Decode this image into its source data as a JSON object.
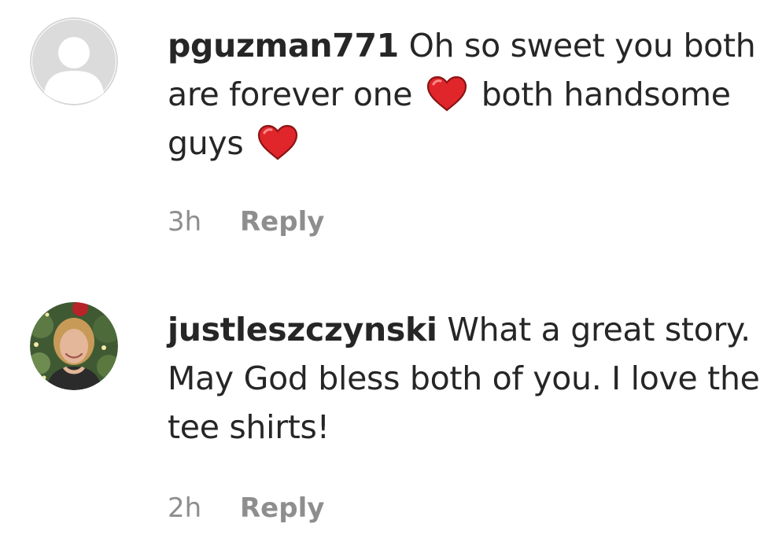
{
  "comments": [
    {
      "username": "pguzman771",
      "text_parts": [
        "Oh so sweet you both are forever one",
        "both handsome guys"
      ],
      "time": "3h",
      "reply_label": "Reply",
      "avatar_icon": "default-avatar-icon",
      "emoji_icon": "red-heart-icon"
    },
    {
      "username": "justleszczynski",
      "text_parts": [
        "What a great story. May God bless both of you. I love the tee shirts!"
      ],
      "time": "2h",
      "reply_label": "Reply",
      "avatar_icon": "profile-photo"
    }
  ],
  "colors": {
    "text": "#262626",
    "secondary": "#8e8e8e",
    "heart": "#e0262b",
    "avatar_placeholder": "#dbdbdb"
  }
}
